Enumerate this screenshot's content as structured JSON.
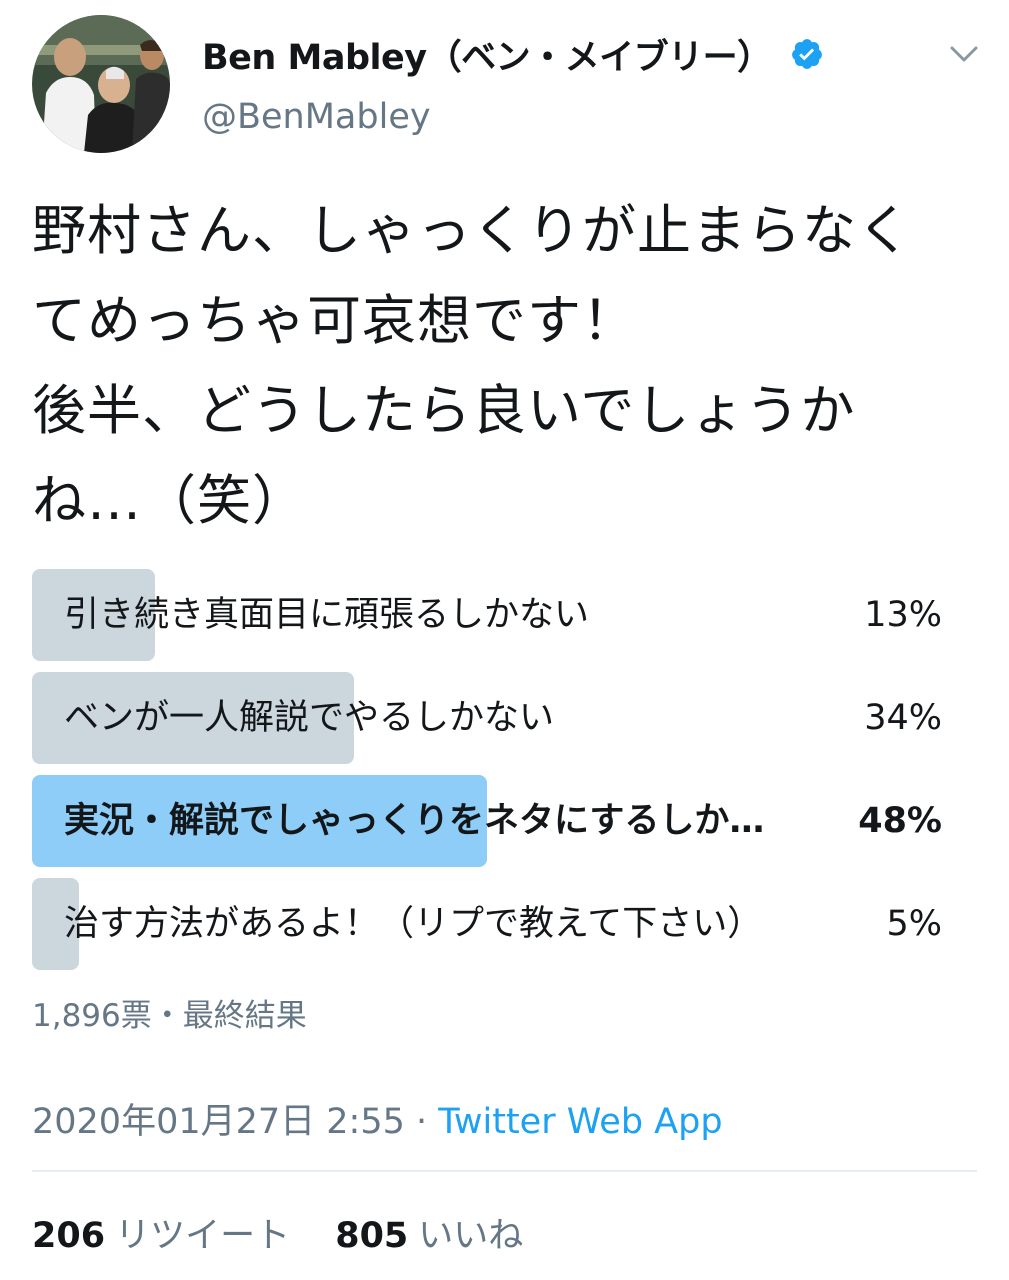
{
  "user": {
    "display_name": "Ben Mabley（ベン・メイブリー）",
    "handle": "@BenMabley",
    "verified": true
  },
  "icons": {
    "avatar": "profile-photo",
    "verified": "verified-badge-icon",
    "menu": "chevron-down-icon"
  },
  "tweet": {
    "lines": [
      "野村さん、しゃっくりが止まらなく",
      "てめっちゃ可哀想です！",
      "後半、どうしたら良いでしょうか",
      "ね…（笑）"
    ]
  },
  "poll": {
    "options": [
      {
        "label": "引き続き真面目に頑張るしかない",
        "percent": 13,
        "percent_text": "13%",
        "winner": false
      },
      {
        "label": "ベンが一人解説でやるしかない",
        "percent": 34,
        "percent_text": "34%",
        "winner": false
      },
      {
        "label": "実況・解説でしゃっくりをネタにするしか…",
        "percent": 48,
        "percent_text": "48%",
        "winner": true
      },
      {
        "label": "治す方法があるよ！（リプで教えて下さい）",
        "percent": 5,
        "percent_text": "5%",
        "winner": false
      }
    ],
    "meta": "1,896票・最終結果"
  },
  "timestamp": "2020年01月27日 2:55",
  "separator": "·",
  "source": "Twitter Web App",
  "stats": {
    "retweets_count": "206",
    "retweets_label": "リツイート",
    "likes_count": "805",
    "likes_label": "いいね"
  },
  "colors": {
    "accent": "#1da1f2",
    "winner_bar": "#8ecdf8",
    "bar": "#ccd6dd",
    "muted_text": "#657786"
  }
}
